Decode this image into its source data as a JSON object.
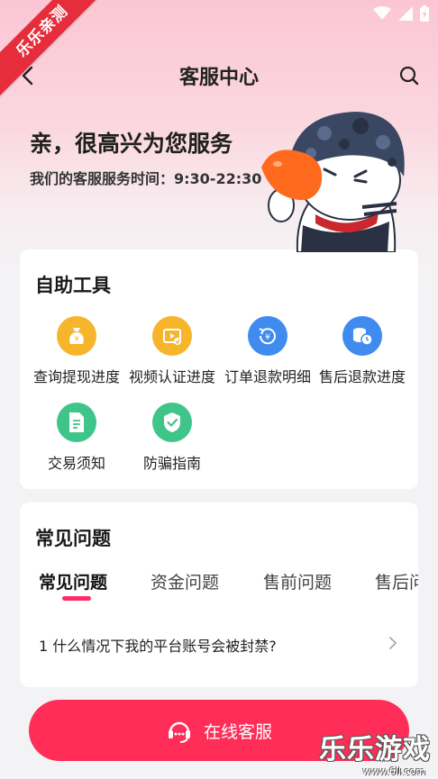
{
  "watermark": {
    "ribbon": "乐乐亲测",
    "brand": "乐乐游戏",
    "url": "www.6ll.com"
  },
  "nav": {
    "title": "客服中心"
  },
  "hero": {
    "greeting": "亲，很高兴为您服务",
    "hours": "我们的客服服务时间：9:30-22:30"
  },
  "tools": {
    "title": "自助工具",
    "items": [
      {
        "label": "查询提现进度",
        "icon": "money-bag-icon",
        "color": "#f6b52b"
      },
      {
        "label": "视频认证进度",
        "icon": "video-verify-icon",
        "color": "#f6b52b"
      },
      {
        "label": "订单退款明细",
        "icon": "refund-icon",
        "color": "#3f8bf0"
      },
      {
        "label": "售后退款进度",
        "icon": "coins-clock-icon",
        "color": "#3f8bf0"
      },
      {
        "label": "交易须知",
        "icon": "document-icon",
        "color": "#3fc58a"
      },
      {
        "label": "防骗指南",
        "icon": "shield-check-icon",
        "color": "#3fc58a"
      }
    ]
  },
  "faq": {
    "title": "常见问题",
    "tabs": [
      "常见问题",
      "资金问题",
      "售前问题",
      "售后问"
    ],
    "active_tab": 0,
    "accent": "#ff2a6a",
    "items": [
      {
        "text": "1  什么情况下我的平台账号会被封禁?"
      }
    ]
  },
  "cta": {
    "label": "在线客服",
    "color": "#ff2d58"
  }
}
